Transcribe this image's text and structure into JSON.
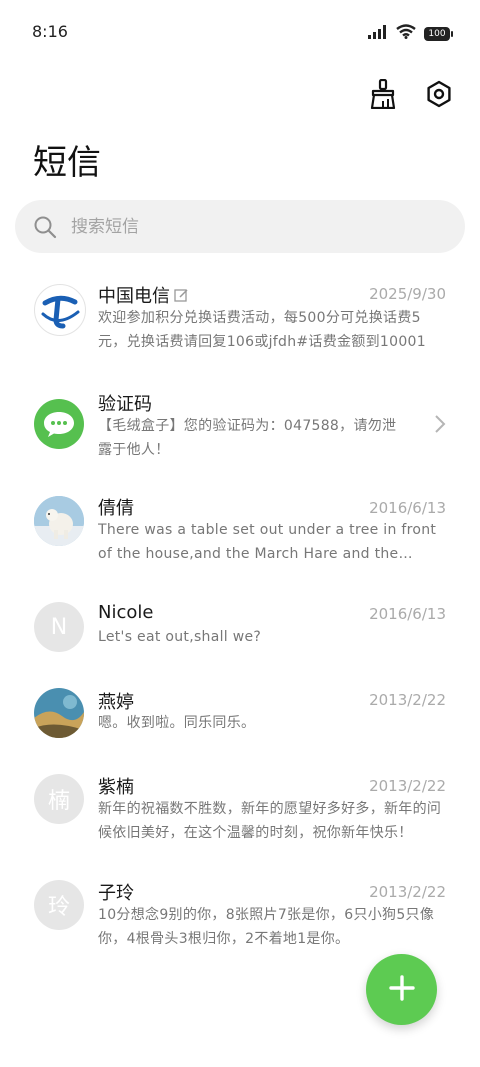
{
  "status": {
    "time": "8:16",
    "battery": "100"
  },
  "header": {
    "title": "短信"
  },
  "search": {
    "placeholder": "搜索短信"
  },
  "conversations": [
    {
      "name": "中国电信",
      "date": "2025/9/30",
      "preview": "欢迎参加积分兑换话费活动，每500分可兑换话费5元，兑换话费请回复106或jfdh#话费金额到10001"
    },
    {
      "name": "验证码",
      "date": "",
      "preview": "【毛绒盒子】您的验证码为：047588，请勿泄露于他人！"
    },
    {
      "name": "倩倩",
      "date": "2016/6/13",
      "preview": "There was a table set out under a tree in front of the house,and the March Hare and the Hatter were having tea at it."
    },
    {
      "name": "Nicole",
      "date": "2016/6/13",
      "preview": "Let's eat out,shall we?",
      "initial": "N"
    },
    {
      "name": "燕婷",
      "date": "2013/2/22",
      "preview": "嗯。收到啦。同乐同乐。"
    },
    {
      "name": "紫楠",
      "date": "2013/2/22",
      "preview": "新年的祝福数不胜数，新年的愿望好多好多，新年的问候依旧美好，在这个温馨的时刻，祝你新年快乐！",
      "initial": "楠"
    },
    {
      "name": "子玲",
      "date": "2013/2/22",
      "preview": "10分想念9别的你，8张照片7张是你，6只小狗5只像你，4根骨头3根归你，2不着地1是你。",
      "initial": "玲"
    }
  ],
  "colors": {
    "accent": "#5dcb52",
    "telecom": "#1a5fb4"
  }
}
